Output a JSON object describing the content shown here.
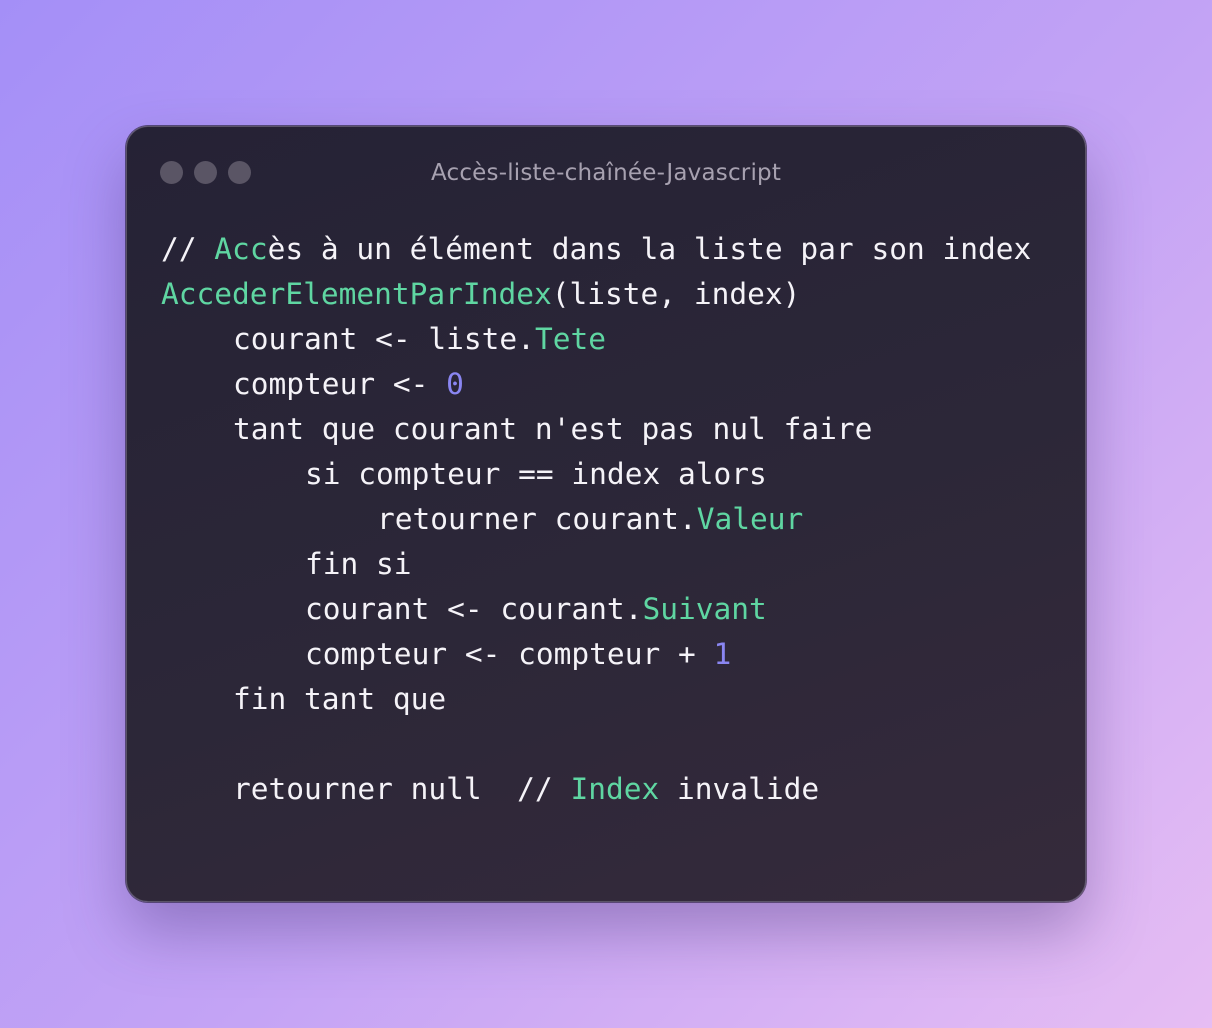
{
  "window": {
    "title": "Accès-liste-chaînée-Javascript"
  },
  "colors": {
    "keyword_green": "#5fd6a2",
    "number_purple": "#8a86f2",
    "text": "#f5f3f8",
    "window_bg": "#2a2637"
  },
  "code": {
    "l1": {
      "a": "// ",
      "b": "Acc",
      "c": "ès à un élément dans la liste par son index"
    },
    "l2": {
      "a": "AccederElementParIndex",
      "b": "(liste, index)"
    },
    "l3": {
      "a": "courant <- liste.",
      "b": "Tete"
    },
    "l4": {
      "a": "compteur <- ",
      "b": "0"
    },
    "l5": {
      "a": "tant que courant n'est pas nul faire"
    },
    "l6": {
      "a": "si compteur == index alors"
    },
    "l7": {
      "a": "retourner courant.",
      "b": "Valeur"
    },
    "l8": {
      "a": "fin si"
    },
    "l9": {
      "a": "courant <- courant.",
      "b": "Suivant"
    },
    "l10": {
      "a": "compteur <- compteur + ",
      "b": "1"
    },
    "l11": {
      "a": "fin tant que"
    },
    "l13": {
      "a": "retourner null  // ",
      "b": "Index",
      "c": " invalide"
    }
  }
}
